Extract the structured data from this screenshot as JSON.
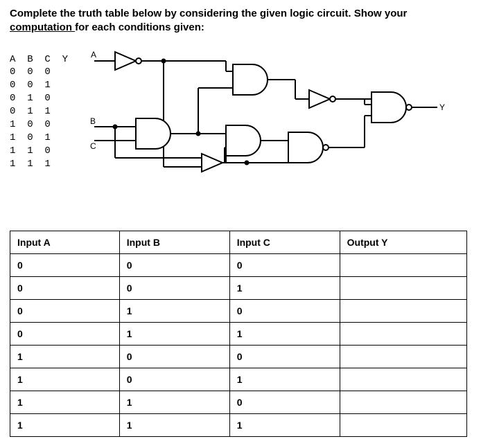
{
  "instruction_lead": "Complete the truth table below by considering the given logic circuit. Show your ",
  "instruction_underlined": "computation ",
  "instruction_trail": "for each conditions given:",
  "mini_table": {
    "header": "A  B  C  Y",
    "rows": [
      "0  0  0",
      "0  0  1",
      "0  1  0",
      "0  1  1",
      "1  0  0",
      "1  0  1",
      "1  1  0",
      "1  1  1"
    ]
  },
  "circuit_labels": {
    "A": "A",
    "B": "B",
    "C": "C",
    "Y": "Y"
  },
  "truth_table": {
    "headers": {
      "a": "Input A",
      "b": "Input B",
      "c": "Input C",
      "y": "Output Y"
    },
    "rows": [
      {
        "a": "0",
        "b": "0",
        "c": "0",
        "y": ""
      },
      {
        "a": "0",
        "b": "0",
        "c": "1",
        "y": ""
      },
      {
        "a": "0",
        "b": "1",
        "c": "0",
        "y": ""
      },
      {
        "a": "0",
        "b": "1",
        "c": "1",
        "y": ""
      },
      {
        "a": "1",
        "b": "0",
        "c": "0",
        "y": ""
      },
      {
        "a": "1",
        "b": "0",
        "c": "1",
        "y": ""
      },
      {
        "a": "1",
        "b": "1",
        "c": "0",
        "y": ""
      },
      {
        "a": "1",
        "b": "1",
        "c": "1",
        "y": ""
      }
    ]
  }
}
